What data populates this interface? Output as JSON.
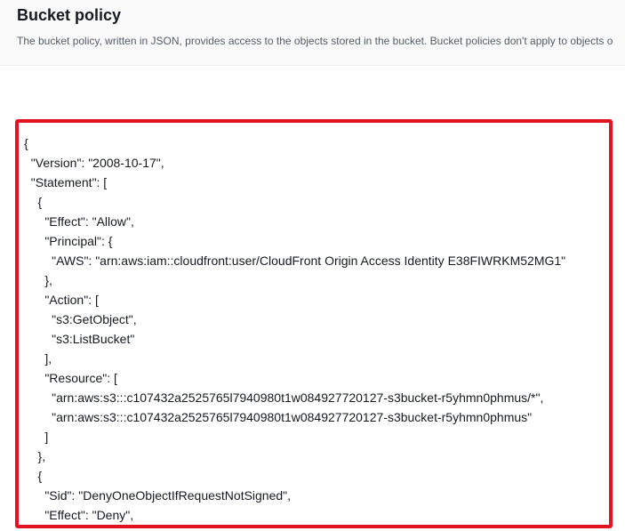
{
  "section": {
    "title": "Bucket policy",
    "description": "The bucket policy, written in JSON, provides access to the objects stored in the bucket. Bucket policies don't apply to objects o"
  },
  "policy_editor": {
    "lines": [
      "{",
      "  \"Version\": \"2008-10-17\",",
      "  \"Statement\": [",
      "    {",
      "      \"Effect\": \"Allow\",",
      "      \"Principal\": {",
      "        \"AWS\": \"arn:aws:iam::cloudfront:user/CloudFront Origin Access Identity E38FIWRKM52MG1\"",
      "      },",
      "      \"Action\": [",
      "        \"s3:GetObject\",",
      "        \"s3:ListBucket\"",
      "      ],",
      "      \"Resource\": [",
      "        \"arn:aws:s3:::c107432a2525765l7940980t1w084927720127-s3bucket-r5yhmn0phmus/*\",",
      "        \"arn:aws:s3:::c107432a2525765l7940980t1w084927720127-s3bucket-r5yhmn0phmus\"",
      "      ]",
      "    },",
      "    {",
      "      \"Sid\": \"DenyOneObjectIfRequestNotSigned\",",
      "      \"Effect\": \"Deny\","
    ]
  },
  "colors": {
    "highlight_border": "#e0151f",
    "header_background": "#fafafa"
  }
}
